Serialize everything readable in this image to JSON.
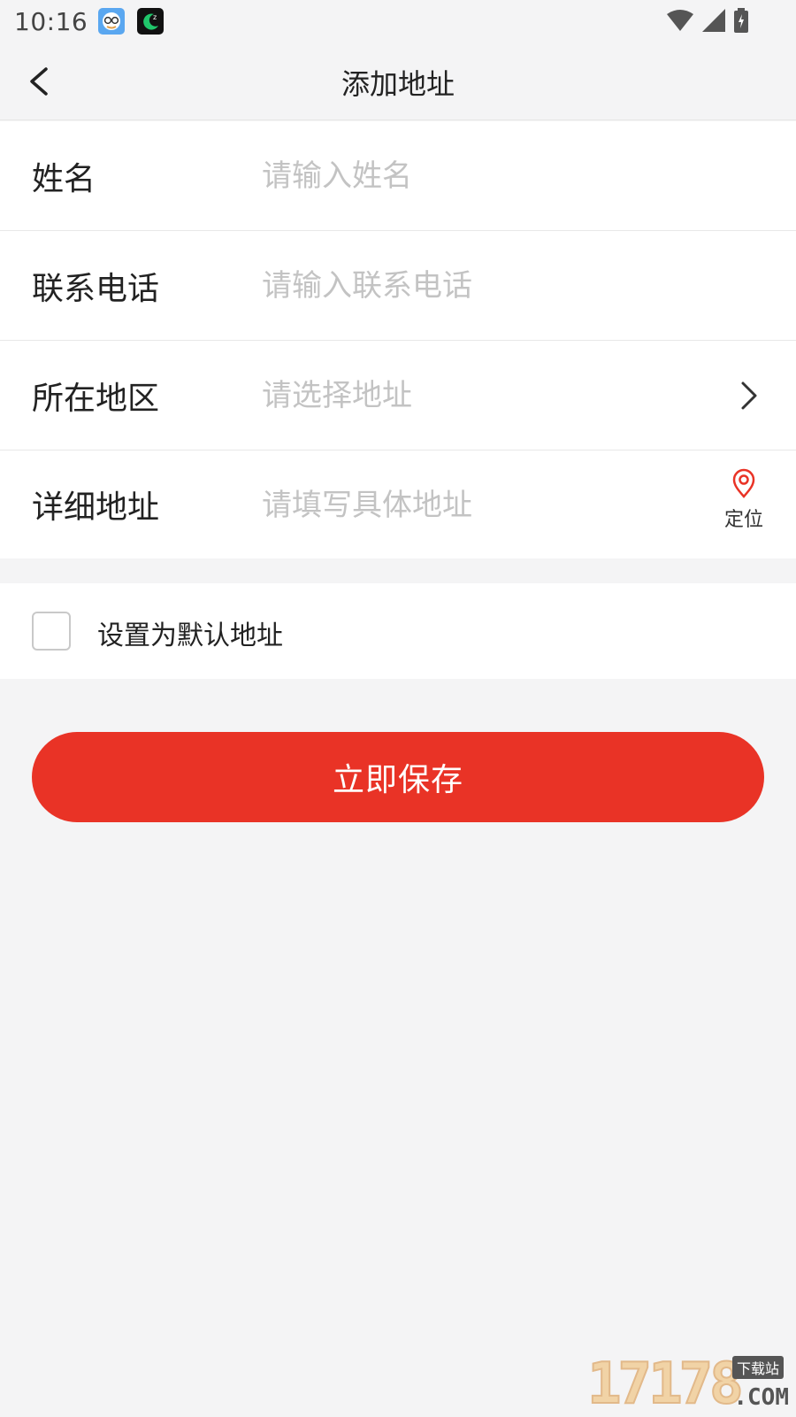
{
  "status_bar": {
    "time": "10:16",
    "icons": [
      "app-icon-qq-face",
      "app-icon-moon",
      "wifi-icon",
      "cellular-signal-icon",
      "battery-charging-icon"
    ]
  },
  "header": {
    "title": "添加地址",
    "back_icon": "chevron-left-icon"
  },
  "form": {
    "name": {
      "label": "姓名",
      "placeholder": "请输入姓名",
      "value": ""
    },
    "phone": {
      "label": "联系电话",
      "placeholder": "请输入联系电话",
      "value": ""
    },
    "region": {
      "label": "所在地区",
      "placeholder": "请选择地址",
      "value": "",
      "icon": "chevron-right-icon"
    },
    "detail": {
      "label": "详细地址",
      "placeholder": "请填写具体地址",
      "value": "",
      "locate_label": "定位",
      "locate_icon": "location-pin-icon"
    }
  },
  "default_address": {
    "label": "设置为默认地址",
    "checked": false
  },
  "save_button": {
    "label": "立即保存"
  },
  "watermark": {
    "digits": "17178",
    "tag": "下载站",
    "domain": ".COM"
  },
  "colors": {
    "accent": "#e93326",
    "background": "#f4f4f5",
    "placeholder": "#c3c3c3"
  }
}
